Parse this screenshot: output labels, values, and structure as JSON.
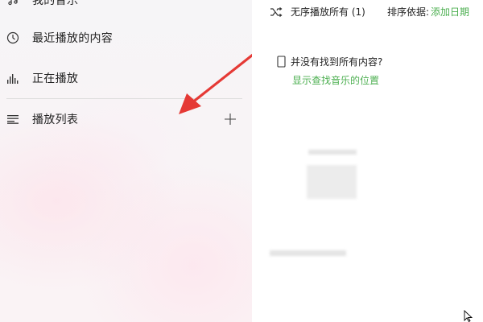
{
  "sidebar": {
    "items": [
      {
        "label": "我的音乐",
        "icon": "music-note-icon"
      },
      {
        "label": "最近播放的内容",
        "icon": "clock-icon"
      },
      {
        "label": "正在播放",
        "icon": "equalizer-icon"
      },
      {
        "label": "播放列表",
        "icon": "playlist-icon"
      }
    ]
  },
  "toolbar": {
    "shuffle_label": "无序播放所有 (1)",
    "sort_label": "排序依据:",
    "sort_value": "添加日期"
  },
  "notice": {
    "question": "并没有找到所有内容?",
    "link": "显示查找音乐的位置"
  },
  "colors": {
    "accent": "#4caf50",
    "annotation": "#e53935"
  }
}
